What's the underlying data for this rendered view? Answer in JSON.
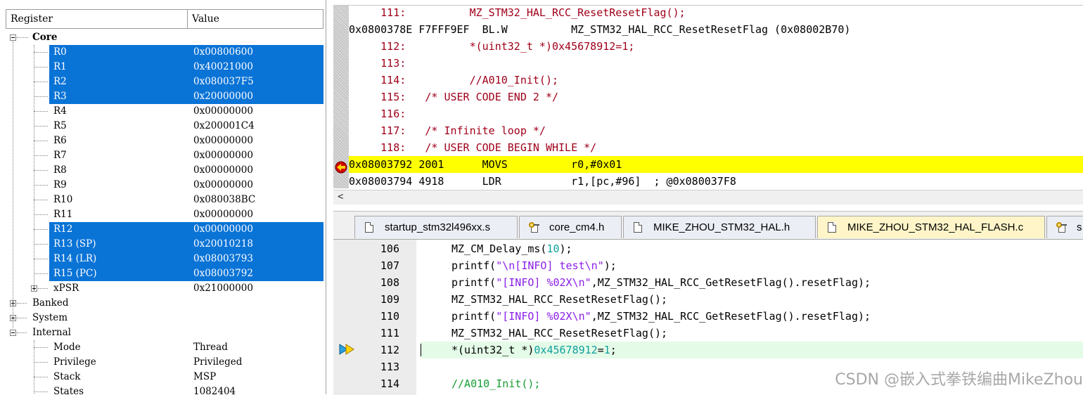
{
  "registers_panel": {
    "columns": [
      "Register",
      "Value"
    ],
    "groups": {
      "core": "Core",
      "banked": "Banked",
      "system": "System",
      "internal": "Internal",
      "xpsr": "xPSR",
      "xpsr_value": "0x21000000"
    },
    "core_registers": [
      {
        "name": "R0",
        "value": "0x00800600",
        "selected": true
      },
      {
        "name": "R1",
        "value": "0x40021000",
        "selected": true
      },
      {
        "name": "R2",
        "value": "0x080037F5",
        "selected": true
      },
      {
        "name": "R3",
        "value": "0x20000000",
        "selected": true
      },
      {
        "name": "R4",
        "value": "0x00000000",
        "selected": false
      },
      {
        "name": "R5",
        "value": "0x200001C4",
        "selected": false
      },
      {
        "name": "R6",
        "value": "0x00000000",
        "selected": false
      },
      {
        "name": "R7",
        "value": "0x00000000",
        "selected": false
      },
      {
        "name": "R8",
        "value": "0x00000000",
        "selected": false
      },
      {
        "name": "R9",
        "value": "0x00000000",
        "selected": false
      },
      {
        "name": "R10",
        "value": "0x080038BC",
        "selected": false
      },
      {
        "name": "R11",
        "value": "0x00000000",
        "selected": false
      },
      {
        "name": "R12",
        "value": "0x00000000",
        "selected": true
      },
      {
        "name": "R13 (SP)",
        "value": "0x20010218",
        "selected": true
      },
      {
        "name": "R14 (LR)",
        "value": "0x08003793",
        "selected": true
      },
      {
        "name": "R15 (PC)",
        "value": "0x08003792",
        "selected": true
      }
    ],
    "internal": [
      {
        "name": "Mode",
        "value": "Thread"
      },
      {
        "name": "Privilege",
        "value": "Privileged"
      },
      {
        "name": "Stack",
        "value": "MSP"
      },
      {
        "name": "States",
        "value": "1082404"
      }
    ]
  },
  "disassembly": {
    "lines": [
      {
        "text": "     111:          MZ_STM32_HAL_RCC_ResetResetFlag();",
        "kind": "src"
      },
      {
        "text": "0x0800378E F7FFF9EF  BL.W          MZ_STM32_HAL_RCC_ResetResetFlag (0x08002B70)",
        "kind": "asm"
      },
      {
        "text": "     112:          *(uint32_t *)0x45678912=1;",
        "kind": "src"
      },
      {
        "text": "     113:",
        "kind": "src"
      },
      {
        "text": "     114:          //A010_Init();",
        "kind": "src"
      },
      {
        "text": "     115:   /* USER CODE END 2 */",
        "kind": "src"
      },
      {
        "text": "     116:",
        "kind": "src"
      },
      {
        "text": "     117:   /* Infinite loop */",
        "kind": "src"
      },
      {
        "text": "     118:   /* USER CODE BEGIN WHILE */",
        "kind": "src"
      },
      {
        "text": "0x08003792 2001      MOVS          r0,#0x01",
        "kind": "asm-current"
      },
      {
        "text": "0x08003794 4918      LDR           r1,[pc,#96]  ; @0x080037F8",
        "kind": "asm"
      }
    ],
    "scroll_left_arrow": "<"
  },
  "tabs": [
    {
      "label": "startup_stm32l496xx.s",
      "icon": "file-icon",
      "active": false
    },
    {
      "label": "core_cm4.h",
      "icon": "header-key-icon",
      "active": false
    },
    {
      "label": "MIKE_ZHOU_STM32_HAL.h",
      "icon": "file-icon",
      "active": false
    },
    {
      "label": "MIKE_ZHOU_STM32_HAL_FLASH.c",
      "icon": "file-icon",
      "active": true
    },
    {
      "label": "s",
      "icon": "header-key-icon",
      "active": false
    }
  ],
  "editor": {
    "lines": [
      {
        "num": "106",
        "code": "MZ_CM_Delay_ms(10);"
      },
      {
        "num": "107",
        "code": "printf(\"\\n[INFO] test\\n\");"
      },
      {
        "num": "108",
        "code": "printf(\"[INFO] %02X\\n\",MZ_STM32_HAL_RCC_GetResetFlag().resetFlag);"
      },
      {
        "num": "109",
        "code": "MZ_STM32_HAL_RCC_ResetResetFlag();"
      },
      {
        "num": "110",
        "code": "printf(\"[INFO] %02X\\n\",MZ_STM32_HAL_RCC_GetResetFlag().resetFlag);"
      },
      {
        "num": "111",
        "code": "MZ_STM32_HAL_RCC_ResetResetFlag();"
      },
      {
        "num": "112",
        "code": "*(uint32_t *)0x45678912=1;"
      },
      {
        "num": "113",
        "code": ""
      },
      {
        "num": "114",
        "code": "//A010_Init();"
      }
    ],
    "current_line": "112"
  },
  "watermark": "CSDN @嵌入式拳铁编曲MikeZhou",
  "colors": {
    "selection": "#0a73d6",
    "current_asm": "#ffff00",
    "current_src": "#e4fbe8",
    "source_text": "#a0001a",
    "active_tab": "#fff5c8"
  }
}
